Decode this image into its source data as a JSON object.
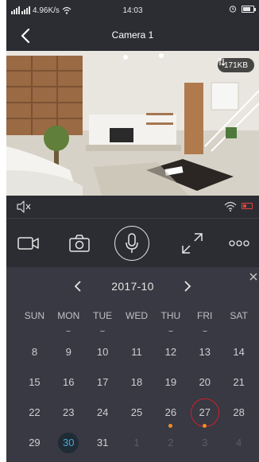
{
  "status_bar": {
    "network": "4.96K/s",
    "time": "14:03"
  },
  "nav": {
    "title": "Camera 1"
  },
  "video": {
    "data_size": "171KB"
  },
  "controls": {
    "icons": [
      "video-record-icon",
      "snapshot-icon",
      "microphone-icon",
      "fullscreen-icon",
      "more-icon"
    ],
    "more_label": "ooo"
  },
  "calendar": {
    "month": "2017-10",
    "weekdays": [
      "SUN",
      "MON",
      "TUE",
      "WED",
      "THU",
      "FRI",
      "SAT"
    ],
    "weeks": [
      [
        "8",
        "9",
        "10",
        "11",
        "12",
        "13",
        "14"
      ],
      [
        "15",
        "16",
        "17",
        "18",
        "19",
        "20",
        "21"
      ],
      [
        "22",
        "23",
        "24",
        "25",
        "26",
        "27",
        "28"
      ],
      [
        "29",
        "30",
        "31",
        "1",
        "2",
        "3",
        "4"
      ]
    ],
    "today": "30",
    "selected": "27",
    "recorded_days": [
      "26",
      "27"
    ],
    "colors": {
      "accent": "#4aa5cf",
      "selected_ring": "#d11f2b",
      "record_dot": "#f08c2a",
      "background": "#383942"
    }
  }
}
